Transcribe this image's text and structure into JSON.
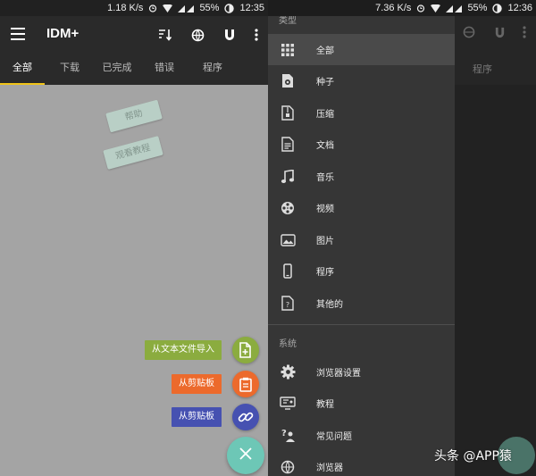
{
  "left": {
    "status": {
      "speed": "1.18 K/s",
      "battery": "55%",
      "time": "12:35"
    },
    "appbar": {
      "title": "IDM+"
    },
    "tabs": [
      "全部",
      "下载",
      "已完成",
      "错误",
      "程序"
    ],
    "help_cards": {
      "help": "帮助",
      "tutorial": "观看教程"
    },
    "fab_actions": [
      {
        "label": "从文本文件导入",
        "color": "#8bac3f"
      },
      {
        "label": "从剪贴板",
        "color": "#ec6a2c"
      },
      {
        "label": "从剪贴板",
        "color": "#4651b1"
      }
    ],
    "fab_main_color": "#6dc7b6"
  },
  "right": {
    "status": {
      "speed": "7.36 K/s",
      "battery": "55%",
      "time": "12:36"
    },
    "behind_tab": "程序",
    "drawer": {
      "section_types": "类型",
      "types": [
        {
          "label": "全部",
          "icon": "grid-icon"
        },
        {
          "label": "种子",
          "icon": "torrent-file-icon"
        },
        {
          "label": "压缩",
          "icon": "archive-file-icon"
        },
        {
          "label": "文档",
          "icon": "document-file-icon"
        },
        {
          "label": "音乐",
          "icon": "music-note-icon"
        },
        {
          "label": "视频",
          "icon": "film-reel-icon"
        },
        {
          "label": "图片",
          "icon": "image-icon"
        },
        {
          "label": "程序",
          "icon": "phone-icon"
        },
        {
          "label": "其他的",
          "icon": "unknown-file-icon"
        }
      ],
      "section_system": "系统",
      "system": [
        {
          "label": "浏览器设置",
          "icon": "gear-icon"
        },
        {
          "label": "教程",
          "icon": "tutorial-icon"
        },
        {
          "label": "常见问题",
          "icon": "faq-icon"
        },
        {
          "label": "浏览器",
          "icon": "globe-icon"
        }
      ]
    },
    "watermark": "头条 @APP猿"
  }
}
